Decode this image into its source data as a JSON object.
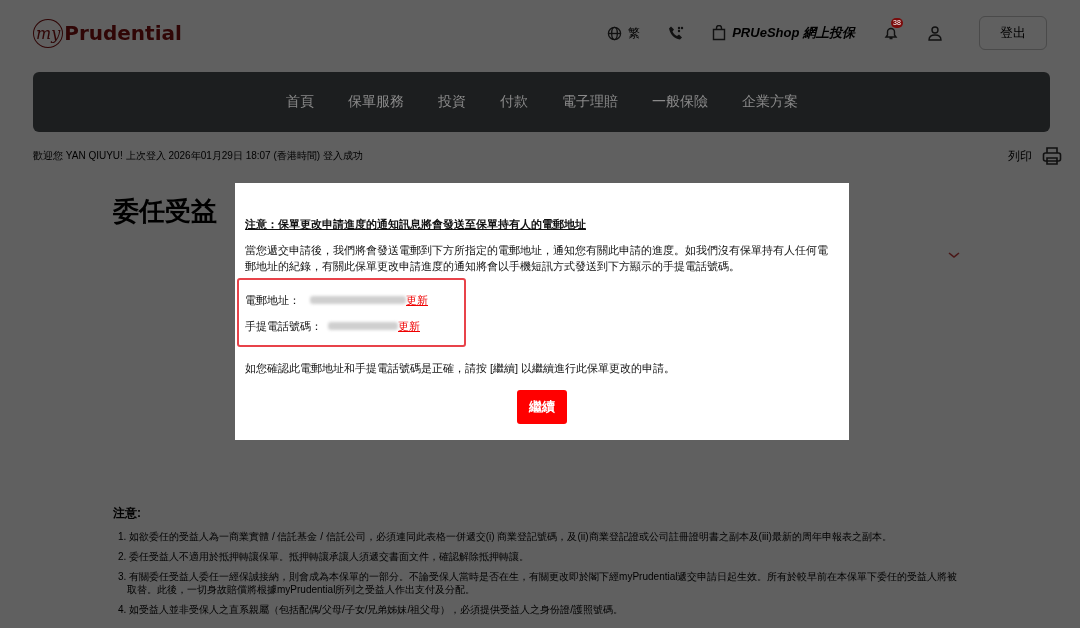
{
  "header": {
    "logo_prefix": "my",
    "logo_name": "Prudential",
    "language": "繁",
    "shop": "PRUeShop 網上投保",
    "notification_count": "38",
    "logout": "登出"
  },
  "nav": [
    {
      "label": "首頁"
    },
    {
      "label": "保單服務"
    },
    {
      "label": "投資"
    },
    {
      "label": "付款"
    },
    {
      "label": "電子理賠"
    },
    {
      "label": "一般保險"
    },
    {
      "label": "企業方案"
    }
  ],
  "welcome": "歡迎您 YAN QIUYU! 上次登入 2026年01月29日 18:07 (香港時間) 登入成功",
  "print": "列印",
  "page_title": "委任受益",
  "notes": {
    "title": "注意:",
    "items": [
      "1. 如欲委任的受益人為一商業實體 / 信託基金 / 信託公司，必須連同此表格一併遞交(i) 商業登記號碼，及(ii)商業登記證或公司註冊證明書之副本及(iii)最新的周年申報表之副本。",
      "2. 委任受益人不適用於抵押轉讓保單。抵押轉讓承讓人須遞交書面文件，確認解除抵押轉讓。",
      "3. 有關委任受益人委任一經保誠接納，則會成為本保單的一部分。不論受保人當時是否在生，有關更改即於閣下經myPrudential遞交申請日起生效。所有於較早前在本保單下委任的受益人將被取替。此後，一切身故賠償將根據myPrudential所列之受益人作出支付及分配。",
      "4. 如受益人並非受保人之直系親屬（包括配偶/父母/子女/兄弟姊妹/祖父母），必須提供受益人之身份證/護照號碼。"
    ]
  },
  "modal": {
    "heading": "注意：保單更改申請進度的通知訊息將會發送至保單持有人的電郵地址",
    "body": "當您遞交申請後，我們將會發送電郵到下方所指定的電郵地址，通知您有關此申請的進度。如我們沒有保單持有人任何電郵地址的紀錄，有關此保單更改申請進度的通知將會以手機短訊方式發送到下方顯示的手提電話號碼。",
    "contacts": [
      {
        "label": "電郵地址：",
        "link": "更新"
      },
      {
        "label": "手提電話號碼：",
        "link": "更新"
      }
    ],
    "confirm": "如您確認此電郵地址和手提電話號碼是正確，請按 [繼續] 以繼續進行此保單更改的申請。",
    "button": "繼續"
  }
}
